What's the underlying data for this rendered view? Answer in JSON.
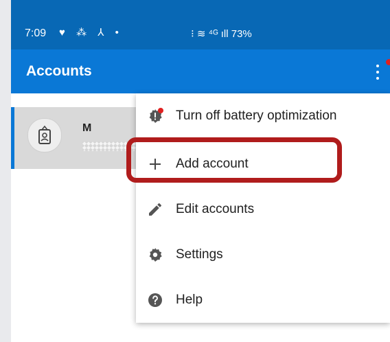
{
  "status_bar": {
    "time": "7:09",
    "left_icons": "♥ ⁂ ⅄ •",
    "right_status": "⁝ ≋ ⁴ᴳ ıll 73%",
    "battery": "73%"
  },
  "app_bar": {
    "title": "Accounts",
    "overflow_icon": "more-vert-icon"
  },
  "account": {
    "name": "M",
    "avatar_icon": "badge-icon"
  },
  "menu": {
    "items": [
      {
        "label": "Turn off battery optimization",
        "icon": "gear-alert-icon"
      },
      {
        "label": "Add account",
        "icon": "plus-icon"
      },
      {
        "label": "Edit accounts",
        "icon": "pencil-icon"
      },
      {
        "label": "Settings",
        "icon": "gear-icon"
      },
      {
        "label": "Help",
        "icon": "help-icon"
      }
    ]
  },
  "colors": {
    "status_bar": "#0868b5",
    "app_bar": "#0a78d6",
    "highlight": "#b01c1c",
    "badge": "#e02020"
  }
}
